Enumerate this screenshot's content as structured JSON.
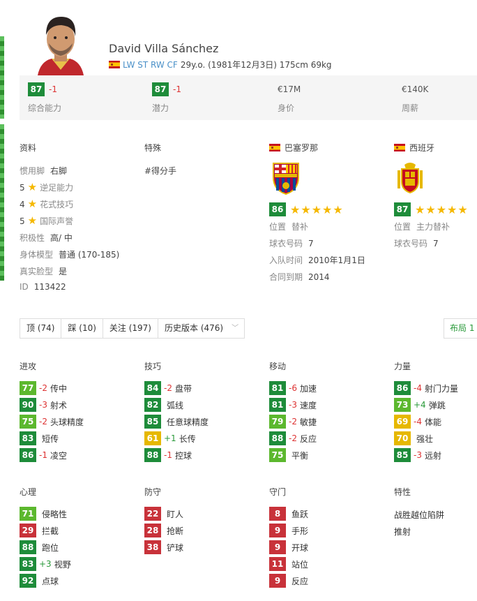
{
  "player": {
    "name": "David Villa Sánchez",
    "positions": "LW ST RW CF",
    "details": "29y.o. (1981年12月3日) 175cm 69kg"
  },
  "summary": {
    "overall": {
      "value": "87",
      "delta": "-1",
      "label": "综合能力"
    },
    "potential": {
      "value": "87",
      "delta": "-1",
      "label": "潜力"
    },
    "value": {
      "value": "€17M",
      "label": "身价"
    },
    "wage": {
      "value": "€140K",
      "label": "周薪"
    }
  },
  "profile": {
    "title": "资料",
    "foot_label": "惯用脚",
    "foot": "右脚",
    "weak_foot_num": "5",
    "weak_foot_label": "逆足能力",
    "skill_num": "4",
    "skill_label": "花式技巧",
    "rep_num": "5",
    "rep_label": "国际声誉",
    "workrate_label": "积极性",
    "workrate": "高/ 中",
    "body_label": "身体模型",
    "body": "普通 (170-185)",
    "realface_label": "真实脸型",
    "realface": "是",
    "id_label": "ID",
    "id": "113422"
  },
  "specialities": {
    "title": "特殊",
    "items": [
      "#得分手"
    ]
  },
  "club": {
    "name": "巴塞罗那",
    "rating": "86",
    "stars": "★★★★★",
    "pos_label": "位置",
    "pos": "替补",
    "kit_label": "球衣号码",
    "kit": "7",
    "joined_label": "入队时间",
    "joined": "2010年1月1日",
    "contract_label": "合同到期",
    "contract": "2014"
  },
  "national": {
    "name": "西班牙",
    "rating": "87",
    "stars": "★★★★★",
    "pos_label": "位置",
    "pos": "主力替补",
    "kit_label": "球衣号码",
    "kit": "7"
  },
  "toolbar": {
    "like": "顶 (74)",
    "dislike": "踩 (10)",
    "follow": "关注 (197)",
    "history": "历史版本 (476)",
    "layout": "布局 1"
  },
  "attributes": {
    "attacking": {
      "title": "进攻",
      "items": [
        {
          "v": "77",
          "c": "g",
          "d": "-2",
          "n": "传中"
        },
        {
          "v": "90",
          "c": "dg",
          "d": "-3",
          "n": "射术"
        },
        {
          "v": "75",
          "c": "g",
          "d": "-2",
          "n": "头球精度"
        },
        {
          "v": "83",
          "c": "dg",
          "d": "",
          "n": "短传"
        },
        {
          "v": "86",
          "c": "dg",
          "d": "-1",
          "n": "凌空"
        }
      ]
    },
    "skill": {
      "title": "技巧",
      "items": [
        {
          "v": "84",
          "c": "dg",
          "d": "-2",
          "n": "盘带"
        },
        {
          "v": "82",
          "c": "dg",
          "d": "",
          "n": "弧线"
        },
        {
          "v": "85",
          "c": "dg",
          "d": "",
          "n": "任意球精度"
        },
        {
          "v": "61",
          "c": "y",
          "d": "+1",
          "n": "长传"
        },
        {
          "v": "88",
          "c": "dg",
          "d": "-1",
          "n": "控球"
        }
      ]
    },
    "movement": {
      "title": "移动",
      "items": [
        {
          "v": "81",
          "c": "dg",
          "d": "-6",
          "n": "加速"
        },
        {
          "v": "81",
          "c": "dg",
          "d": "-3",
          "n": "速度"
        },
        {
          "v": "79",
          "c": "g",
          "d": "-2",
          "n": "敏捷"
        },
        {
          "v": "88",
          "c": "dg",
          "d": "-2",
          "n": "反应"
        },
        {
          "v": "75",
          "c": "g",
          "d": "",
          "n": "平衡"
        }
      ]
    },
    "power": {
      "title": "力量",
      "items": [
        {
          "v": "86",
          "c": "dg",
          "d": "-4",
          "n": "射门力量"
        },
        {
          "v": "73",
          "c": "g",
          "d": "+4",
          "n": "弹跳"
        },
        {
          "v": "69",
          "c": "y",
          "d": "-4",
          "n": "体能"
        },
        {
          "v": "70",
          "c": "y",
          "d": "",
          "n": "强壮"
        },
        {
          "v": "85",
          "c": "dg",
          "d": "-3",
          "n": "远射"
        }
      ]
    },
    "mentality": {
      "title": "心理",
      "items": [
        {
          "v": "71",
          "c": "g",
          "d": "",
          "n": "侵略性"
        },
        {
          "v": "29",
          "c": "r",
          "d": "",
          "n": "拦截"
        },
        {
          "v": "88",
          "c": "dg",
          "d": "",
          "n": "跑位"
        },
        {
          "v": "83",
          "c": "dg",
          "d": "+3",
          "n": "视野"
        },
        {
          "v": "92",
          "c": "dg",
          "d": "",
          "n": "点球"
        }
      ]
    },
    "defending": {
      "title": "防守",
      "items": [
        {
          "v": "22",
          "c": "r",
          "d": "",
          "n": "盯人"
        },
        {
          "v": "28",
          "c": "r",
          "d": "",
          "n": "抢断"
        },
        {
          "v": "38",
          "c": "r",
          "d": "",
          "n": "铲球"
        }
      ]
    },
    "goalkeeping": {
      "title": "守门",
      "items": [
        {
          "v": "8",
          "c": "r",
          "d": "",
          "n": "鱼跃"
        },
        {
          "v": "9",
          "c": "r",
          "d": "",
          "n": "手形"
        },
        {
          "v": "9",
          "c": "r",
          "d": "",
          "n": "开球"
        },
        {
          "v": "11",
          "c": "r",
          "d": "",
          "n": "站位"
        },
        {
          "v": "9",
          "c": "r",
          "d": "",
          "n": "反应"
        }
      ]
    },
    "traits": {
      "title": "特性",
      "items": [
        "战胜越位陷阱",
        "推射"
      ]
    }
  }
}
